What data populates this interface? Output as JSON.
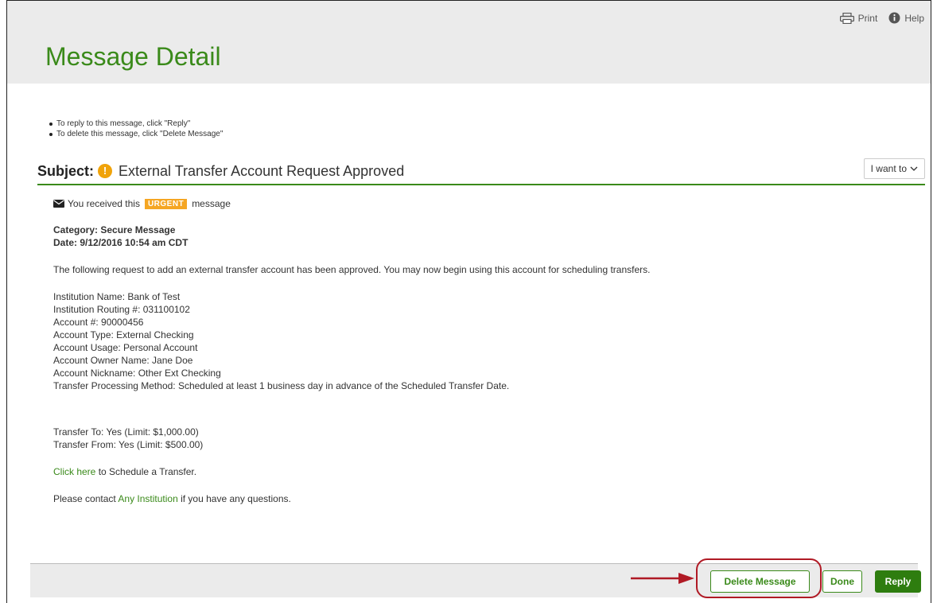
{
  "header": {
    "print_label": "Print",
    "help_label": "Help",
    "title": "Message Detail"
  },
  "instructions": [
    "To reply to this message, click \"Reply\"",
    "To delete this message, click \"Delete Message\""
  ],
  "subject": {
    "label": "Subject:",
    "text": "External Transfer Account Request Approved",
    "menu_label": "I want to"
  },
  "message": {
    "received_prefix": "You received this",
    "urgency_badge": "URGENT",
    "received_suffix": "message",
    "category": "Category: Secure Message",
    "date": "Date: 9/12/2016 10:54 am CDT",
    "intro": "The following request to add an external transfer account has been approved. You may now begin using this account for scheduling transfers.",
    "details": [
      "Institution Name: Bank of Test",
      "Institution Routing #: 031100102",
      "Account #: 90000456",
      "Account Type: External Checking",
      "Account Usage: Personal Account",
      "Account Owner Name: Jane Doe",
      "Account Nickname: Other Ext Checking",
      "Transfer Processing Method: Scheduled at least 1 business day in advance of the Scheduled Transfer Date."
    ],
    "limits": [
      "Transfer To: Yes (Limit: $1,000.00)",
      "Transfer From: Yes (Limit: $500.00)"
    ],
    "schedule_link": "Click here",
    "schedule_suffix": " to Schedule a Transfer.",
    "contact_prefix": "Please contact ",
    "contact_link": "Any Institution",
    "contact_suffix": " if you have any questions."
  },
  "footer": {
    "delete_label": "Delete Message",
    "done_label": "Done",
    "reply_label": "Reply"
  },
  "colors": {
    "brand_green": "#3a8a1a",
    "urgent_orange": "#f5a623",
    "annotation_red": "#b01a25"
  }
}
